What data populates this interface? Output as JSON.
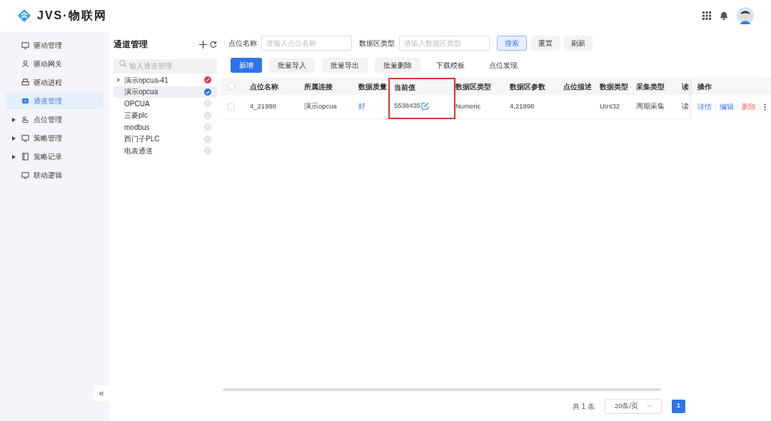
{
  "app": {
    "logo_text": "JVS·物联网"
  },
  "sidebar": {
    "items": [
      {
        "label": "驱动管理",
        "expandable": false,
        "selected": false
      },
      {
        "label": "驱动网关",
        "expandable": false,
        "selected": false
      },
      {
        "label": "驱动进程",
        "expandable": false,
        "selected": false
      },
      {
        "label": "通道管理",
        "expandable": false,
        "selected": true
      },
      {
        "label": "点位管理",
        "expandable": true,
        "selected": false
      },
      {
        "label": "策略管理",
        "expandable": true,
        "selected": false
      },
      {
        "label": "策略记录",
        "expandable": true,
        "selected": false
      },
      {
        "label": "联动逻辑",
        "expandable": false,
        "selected": false
      }
    ],
    "collapse": "«"
  },
  "channel_panel": {
    "title": "通道管理",
    "search": {
      "placeholder": "输入通道管理"
    },
    "items": [
      {
        "label": "演示opcua-41",
        "kind": "error",
        "expandable": true,
        "selected": false
      },
      {
        "label": "演示opcua",
        "kind": "ok",
        "expandable": false,
        "selected": true
      },
      {
        "label": "OPCUA",
        "kind": "idle",
        "expandable": false,
        "selected": false
      },
      {
        "label": "三菱plc",
        "kind": "idle",
        "expandable": false,
        "selected": false
      },
      {
        "label": "modbus",
        "kind": "idle",
        "expandable": false,
        "selected": false
      },
      {
        "label": "西门子PLC",
        "kind": "idle",
        "expandable": false,
        "selected": false
      },
      {
        "label": "电表通道",
        "kind": "idle",
        "expandable": false,
        "selected": false
      }
    ]
  },
  "filters": [
    {
      "label": "点位名称",
      "placeholder": "请输入点位名称"
    },
    {
      "label": "数据区类型",
      "placeholder": "请输入数据区类型"
    }
  ],
  "filter_buttons": [
    {
      "label": "搜索",
      "kind": "primary"
    },
    {
      "label": "重置",
      "kind": "plain"
    },
    {
      "label": "刷新",
      "kind": "plain"
    }
  ],
  "toolbar": [
    {
      "label": "新增",
      "kind": "primary"
    },
    {
      "label": "批量导入",
      "kind": "plain"
    },
    {
      "label": "批量导出",
      "kind": "plain"
    },
    {
      "label": "批量删除",
      "kind": "plain"
    },
    {
      "label": "下载模板",
      "kind": "text"
    },
    {
      "label": "点位发现",
      "kind": "text"
    }
  ],
  "table": {
    "columns": [
      {
        "label": "点位名称",
        "highlighted": false
      },
      {
        "label": "所属连接",
        "highlighted": false
      },
      {
        "label": "数据质量",
        "highlighted": false
      },
      {
        "label": "当前值",
        "highlighted": true
      },
      {
        "label": "数据区类型",
        "highlighted": false
      },
      {
        "label": "数据区参数",
        "highlighted": false
      },
      {
        "label": "点位描述",
        "highlighted": false
      },
      {
        "label": "数据类型",
        "highlighted": false
      },
      {
        "label": "采集类型",
        "highlighted": false
      },
      {
        "label": "读",
        "highlighted": false
      }
    ],
    "action_column": "操作",
    "all_checked": false,
    "rows": [
      {
        "checked": false,
        "cells": [
          "4_21998",
          "演示opcua",
          "好",
          "5538435",
          "Numeric",
          "4,21998",
          "",
          "UInt32",
          "周期采集",
          "读"
        ],
        "actions": [
          {
            "label": "详情",
            "kind": "link"
          },
          {
            "label": "编辑",
            "kind": "link"
          },
          {
            "label": "删除",
            "kind": "danger"
          }
        ]
      }
    ]
  },
  "pagination": {
    "total": "共 1 条",
    "page_size": "20条/页",
    "pages": [
      {
        "label": "1",
        "selected": true
      }
    ]
  }
}
